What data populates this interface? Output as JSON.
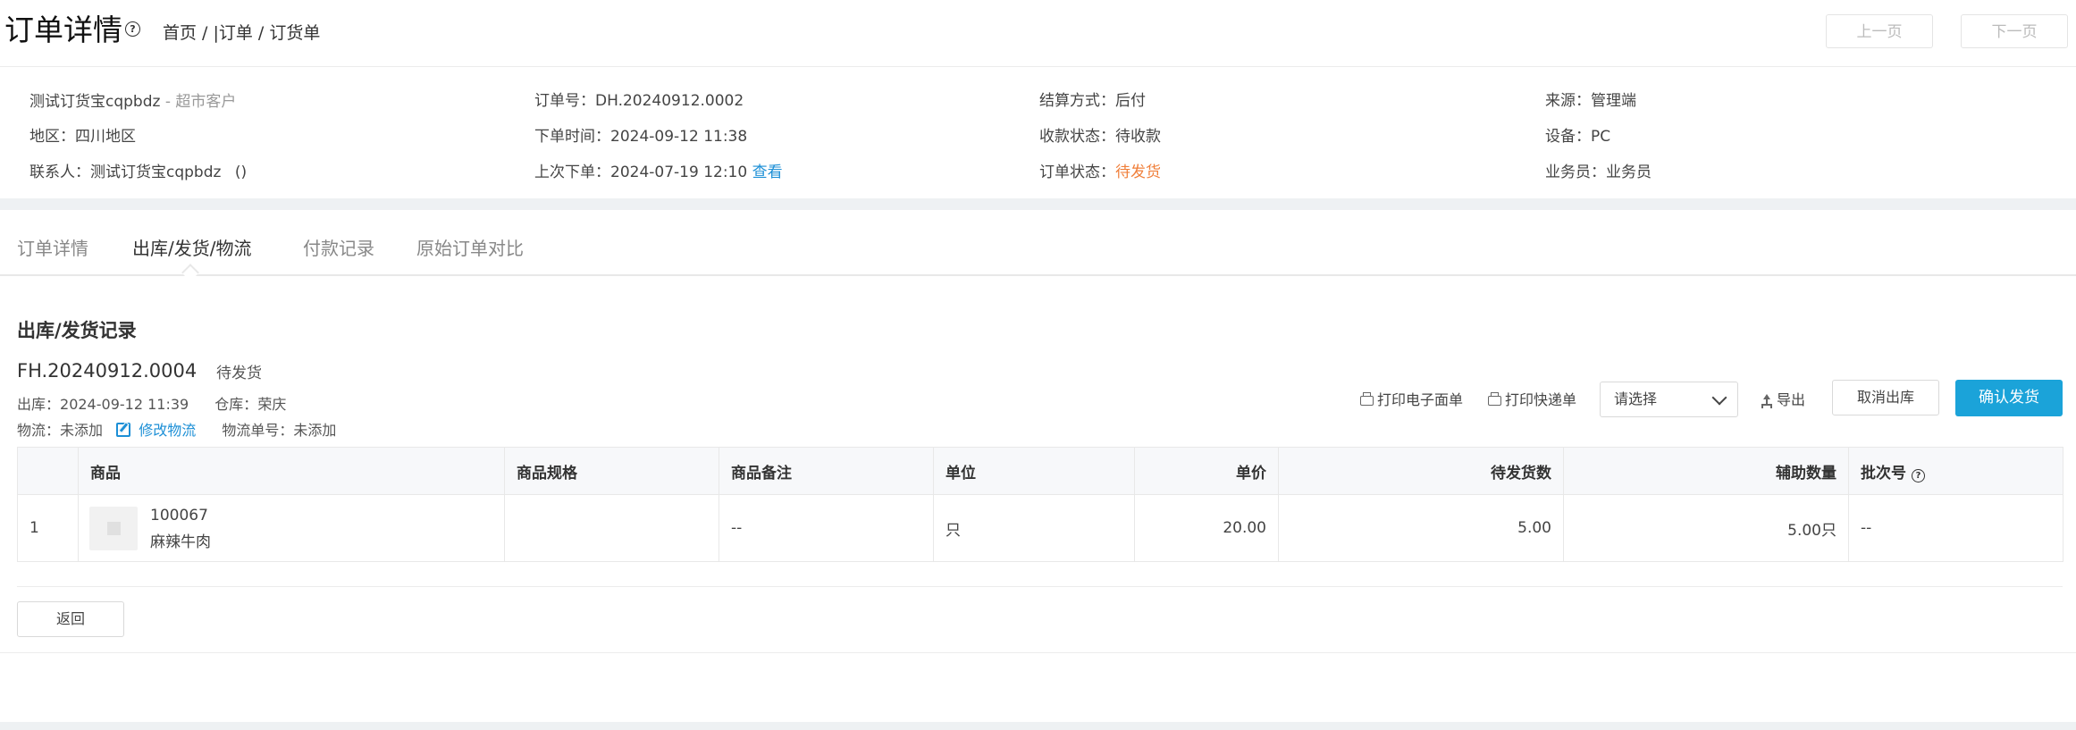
{
  "header": {
    "title": "订单详情",
    "breadcrumb": "首页 / |订单 / 订货单",
    "prev_label": "上一页",
    "next_label": "下一页"
  },
  "info": {
    "customer_name": "测试订货宝cqpbdz",
    "customer_type": "- 超市客户",
    "region_label": "地区：",
    "region_value": "四川地区",
    "contact_label": "联系人：",
    "contact_value": "测试订货宝cqpbdz",
    "contact_phone": "()",
    "order_no_label": "订单号：",
    "order_no_value": "DH.20240912.0002",
    "order_time_label": "下单时间：",
    "order_time_value": "2024-09-12 11:38",
    "last_order_label": "上次下单：",
    "last_order_value": "2024-07-19 12:10",
    "view_link": "查看",
    "settlement_label": "结算方式：",
    "settlement_value": "后付",
    "payment_status_label": "收款状态：",
    "payment_status_value": "待收款",
    "order_status_label": "订单状态：",
    "order_status_value": "待发货",
    "source_label": "来源：",
    "source_value": "管理端",
    "device_label": "设备：",
    "device_value": "PC",
    "salesman_label": "业务员：",
    "salesman_value": "业务员"
  },
  "tabs": [
    {
      "label": "订单详情",
      "active": false
    },
    {
      "label": "出库/发货/物流",
      "active": true
    },
    {
      "label": "付款记录",
      "active": false
    },
    {
      "label": "原始订单对比",
      "active": false
    }
  ],
  "shipment": {
    "section_title": "出库/发货记录",
    "number": "FH.20240912.0004",
    "status": "待发货",
    "outbound_label": "出库：",
    "outbound_time": "2024-09-12 11:39",
    "warehouse_label": "仓库：",
    "warehouse_value": "荣庆",
    "logistics_label": "物流：",
    "logistics_value": "未添加",
    "edit_logistics": "修改物流",
    "tracking_label": "物流单号：",
    "tracking_value": "未添加"
  },
  "toolbar": {
    "print_electronic": "打印电子面单",
    "print_express": "打印快递单",
    "select_placeholder": "请选择",
    "export": "导出",
    "cancel_outbound": "取消出库",
    "confirm_ship": "确认发货"
  },
  "table": {
    "headers": [
      "",
      "商品",
      "商品规格",
      "商品备注",
      "单位",
      "单价",
      "待发货数",
      "辅助数量",
      "批次号"
    ],
    "rows": [
      {
        "index": "1",
        "code": "100067",
        "name": "麻辣牛肉",
        "spec": "",
        "remark": "--",
        "unit": "只",
        "price": "20.00",
        "pending_qty": "5.00",
        "aux_qty": "5.00只",
        "batch": "--"
      }
    ]
  },
  "footer": {
    "back_label": "返回"
  },
  "colors": {
    "accent_blue": "#1ba3d9",
    "link_blue": "#1c8fd6",
    "status_orange": "#f07f3a"
  }
}
